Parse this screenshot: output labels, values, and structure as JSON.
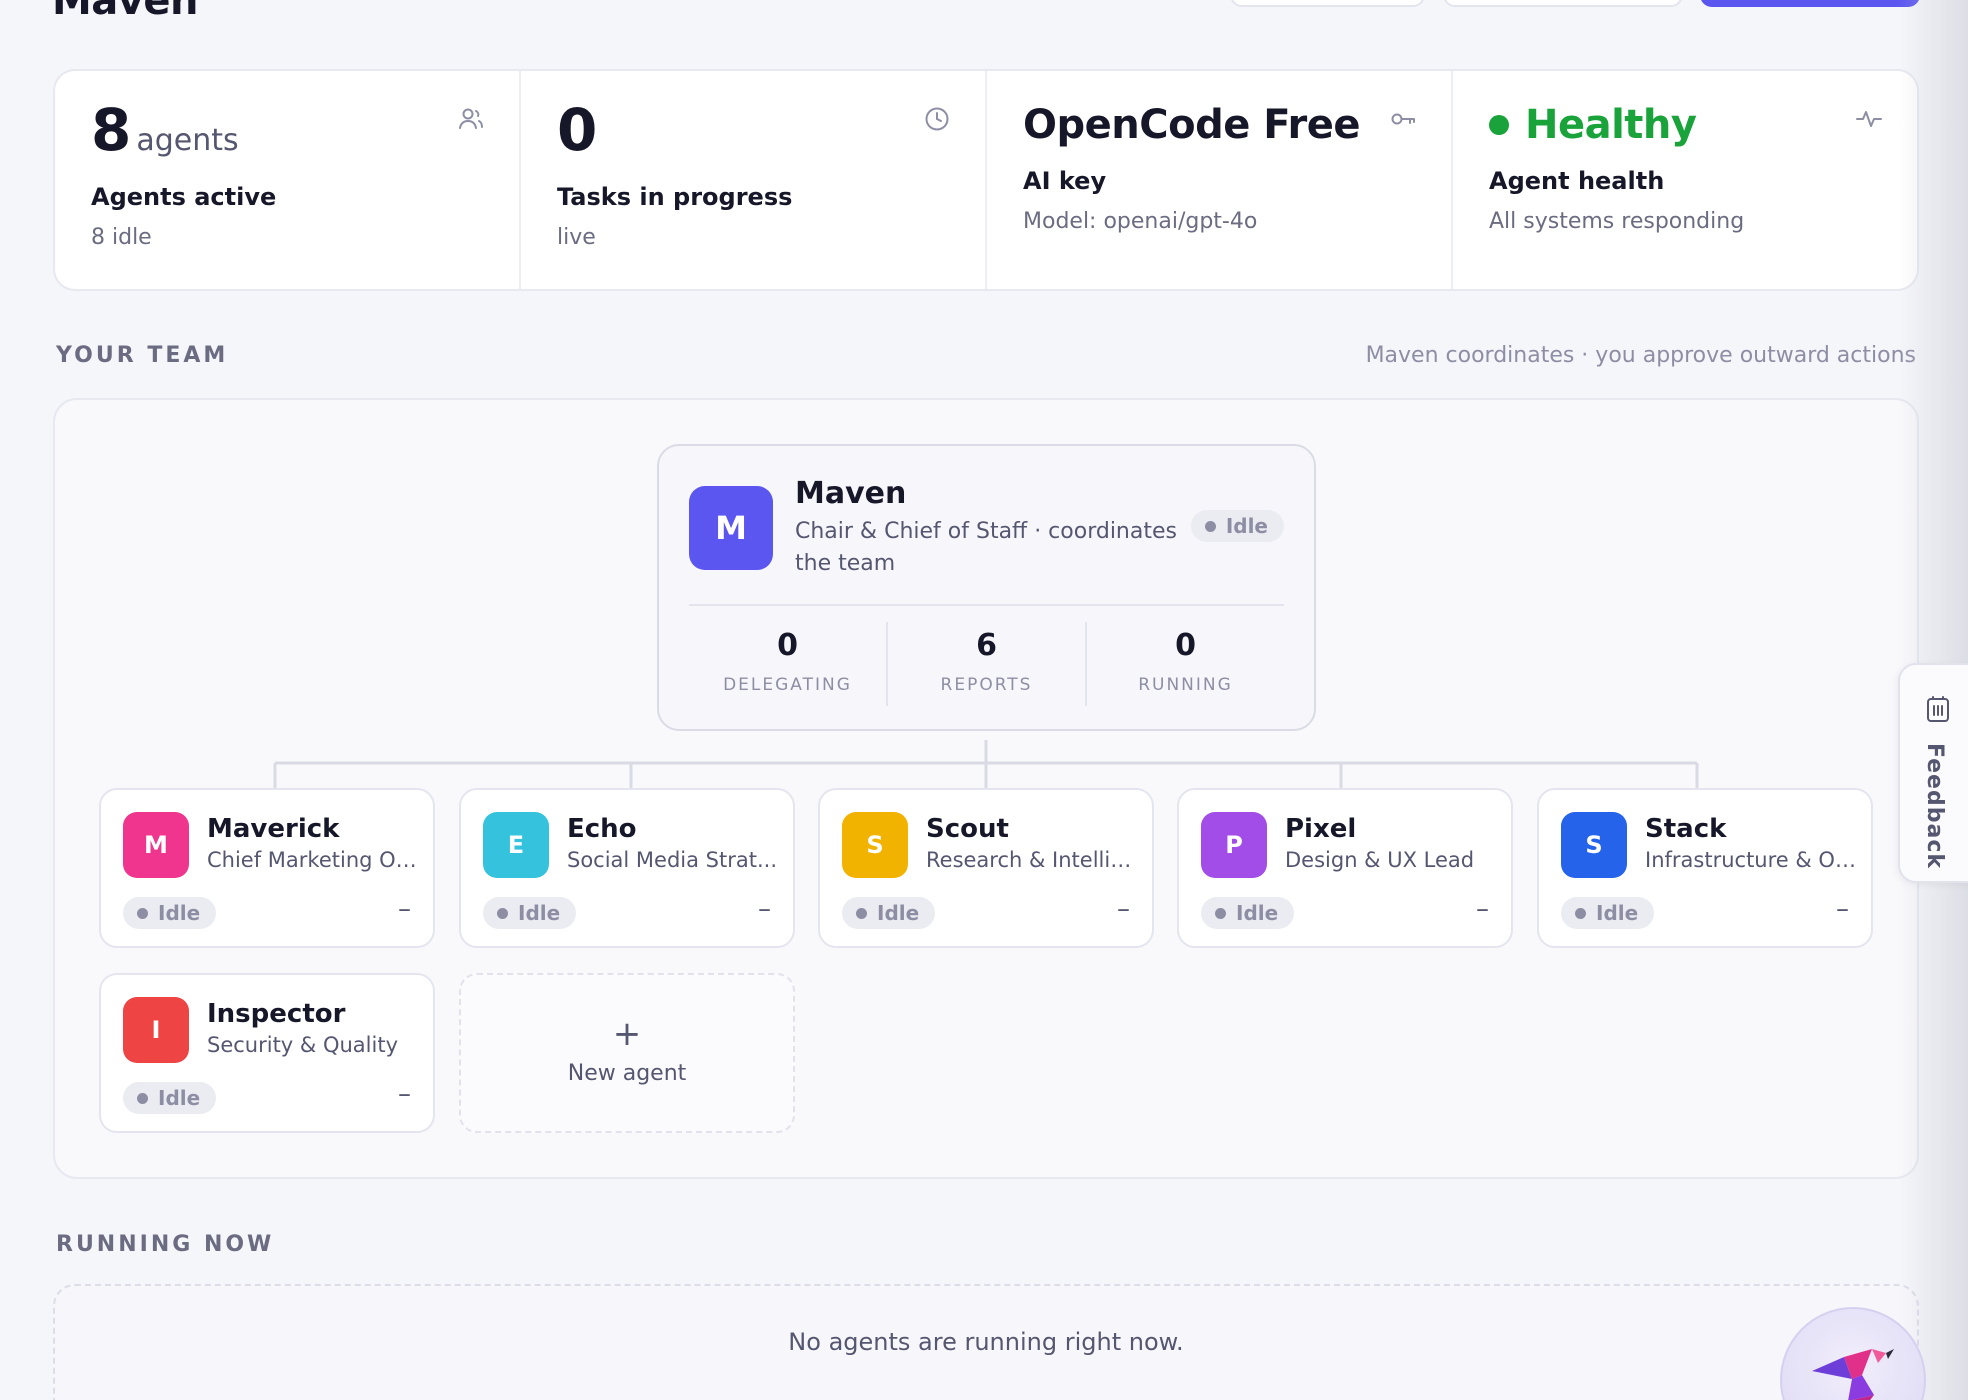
{
  "app": {
    "title": "Maven"
  },
  "colors": {
    "accent": "#5b56f0",
    "healthy": "#19a33a",
    "maven": "#5b56f0",
    "maverick": "#f0358f",
    "echo": "#35c2dc",
    "scout": "#f2b200",
    "pixel": "#a24de8",
    "stack": "#2563eb",
    "inspector": "#ef4444"
  },
  "stats": {
    "agents": {
      "value": "8",
      "unit": "agents",
      "label": "Agents active",
      "sub": "8 idle",
      "icon": "users-icon"
    },
    "tasks": {
      "value": "0",
      "label": "Tasks in progress",
      "sub": "live",
      "icon": "clock-icon"
    },
    "ai": {
      "value": "OpenCode Free",
      "label": "AI key",
      "sub": "Model: openai/gpt-4o",
      "icon": "key-icon"
    },
    "health": {
      "value": "Healthy",
      "label": "Agent health",
      "sub": "All systems responding",
      "icon": "pulse-icon"
    }
  },
  "team": {
    "heading": "YOUR TEAM",
    "note": "Maven coordinates · you approve outward actions",
    "chair": {
      "initial": "M",
      "name": "Maven",
      "role": "Chair & Chief of Staff · coordinates the team",
      "status": "Idle",
      "metrics": [
        {
          "value": "0",
          "label": "DELEGATING"
        },
        {
          "value": "6",
          "label": "REPORTS"
        },
        {
          "value": "0",
          "label": "RUNNING"
        }
      ]
    },
    "agents": [
      {
        "initial": "M",
        "name": "Maverick",
        "role": "Chief Marketing Of...",
        "status": "Idle",
        "activity": "–"
      },
      {
        "initial": "E",
        "name": "Echo",
        "role": "Social Media Strat...",
        "status": "Idle",
        "activity": "–"
      },
      {
        "initial": "S",
        "name": "Scout",
        "role": "Research & Intellig...",
        "status": "Idle",
        "activity": "–"
      },
      {
        "initial": "P",
        "name": "Pixel",
        "role": "Design & UX Lead",
        "status": "Idle",
        "activity": "–"
      },
      {
        "initial": "S",
        "name": "Stack",
        "role": "Infrastructure & Ops",
        "status": "Idle",
        "activity": "–"
      },
      {
        "initial": "I",
        "name": "Inspector",
        "role": "Security & Quality",
        "status": "Idle",
        "activity": "–"
      }
    ],
    "new_agent": {
      "icon": "+",
      "label": "New agent"
    }
  },
  "running": {
    "heading": "RUNNING NOW",
    "empty": "No agents are running right now."
  },
  "feedback": {
    "label": "Feedback",
    "icon": "feedback-icon"
  }
}
